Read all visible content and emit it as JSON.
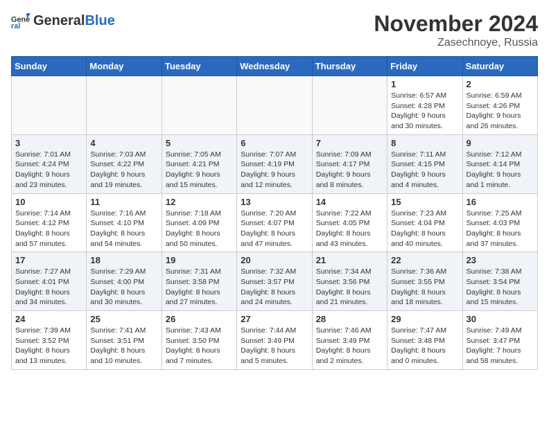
{
  "logo": {
    "text_general": "General",
    "text_blue": "Blue"
  },
  "title": {
    "month": "November 2024",
    "location": "Zasechnoye, Russia"
  },
  "weekdays": [
    "Sunday",
    "Monday",
    "Tuesday",
    "Wednesday",
    "Thursday",
    "Friday",
    "Saturday"
  ],
  "weeks": [
    [
      {
        "day": "",
        "info": ""
      },
      {
        "day": "",
        "info": ""
      },
      {
        "day": "",
        "info": ""
      },
      {
        "day": "",
        "info": ""
      },
      {
        "day": "",
        "info": ""
      },
      {
        "day": "1",
        "info": "Sunrise: 6:57 AM\nSunset: 4:28 PM\nDaylight: 9 hours and 30 minutes."
      },
      {
        "day": "2",
        "info": "Sunrise: 6:59 AM\nSunset: 4:26 PM\nDaylight: 9 hours and 26 minutes."
      }
    ],
    [
      {
        "day": "3",
        "info": "Sunrise: 7:01 AM\nSunset: 4:24 PM\nDaylight: 9 hours and 23 minutes."
      },
      {
        "day": "4",
        "info": "Sunrise: 7:03 AM\nSunset: 4:22 PM\nDaylight: 9 hours and 19 minutes."
      },
      {
        "day": "5",
        "info": "Sunrise: 7:05 AM\nSunset: 4:21 PM\nDaylight: 9 hours and 15 minutes."
      },
      {
        "day": "6",
        "info": "Sunrise: 7:07 AM\nSunset: 4:19 PM\nDaylight: 9 hours and 12 minutes."
      },
      {
        "day": "7",
        "info": "Sunrise: 7:09 AM\nSunset: 4:17 PM\nDaylight: 9 hours and 8 minutes."
      },
      {
        "day": "8",
        "info": "Sunrise: 7:11 AM\nSunset: 4:15 PM\nDaylight: 9 hours and 4 minutes."
      },
      {
        "day": "9",
        "info": "Sunrise: 7:12 AM\nSunset: 4:14 PM\nDaylight: 9 hours and 1 minute."
      }
    ],
    [
      {
        "day": "10",
        "info": "Sunrise: 7:14 AM\nSunset: 4:12 PM\nDaylight: 8 hours and 57 minutes."
      },
      {
        "day": "11",
        "info": "Sunrise: 7:16 AM\nSunset: 4:10 PM\nDaylight: 8 hours and 54 minutes."
      },
      {
        "day": "12",
        "info": "Sunrise: 7:18 AM\nSunset: 4:09 PM\nDaylight: 8 hours and 50 minutes."
      },
      {
        "day": "13",
        "info": "Sunrise: 7:20 AM\nSunset: 4:07 PM\nDaylight: 8 hours and 47 minutes."
      },
      {
        "day": "14",
        "info": "Sunrise: 7:22 AM\nSunset: 4:05 PM\nDaylight: 8 hours and 43 minutes."
      },
      {
        "day": "15",
        "info": "Sunrise: 7:23 AM\nSunset: 4:04 PM\nDaylight: 8 hours and 40 minutes."
      },
      {
        "day": "16",
        "info": "Sunrise: 7:25 AM\nSunset: 4:03 PM\nDaylight: 8 hours and 37 minutes."
      }
    ],
    [
      {
        "day": "17",
        "info": "Sunrise: 7:27 AM\nSunset: 4:01 PM\nDaylight: 8 hours and 34 minutes."
      },
      {
        "day": "18",
        "info": "Sunrise: 7:29 AM\nSunset: 4:00 PM\nDaylight: 8 hours and 30 minutes."
      },
      {
        "day": "19",
        "info": "Sunrise: 7:31 AM\nSunset: 3:58 PM\nDaylight: 8 hours and 27 minutes."
      },
      {
        "day": "20",
        "info": "Sunrise: 7:32 AM\nSunset: 3:57 PM\nDaylight: 8 hours and 24 minutes."
      },
      {
        "day": "21",
        "info": "Sunrise: 7:34 AM\nSunset: 3:56 PM\nDaylight: 8 hours and 21 minutes."
      },
      {
        "day": "22",
        "info": "Sunrise: 7:36 AM\nSunset: 3:55 PM\nDaylight: 8 hours and 18 minutes."
      },
      {
        "day": "23",
        "info": "Sunrise: 7:38 AM\nSunset: 3:54 PM\nDaylight: 8 hours and 15 minutes."
      }
    ],
    [
      {
        "day": "24",
        "info": "Sunrise: 7:39 AM\nSunset: 3:52 PM\nDaylight: 8 hours and 13 minutes."
      },
      {
        "day": "25",
        "info": "Sunrise: 7:41 AM\nSunset: 3:51 PM\nDaylight: 8 hours and 10 minutes."
      },
      {
        "day": "26",
        "info": "Sunrise: 7:43 AM\nSunset: 3:50 PM\nDaylight: 8 hours and 7 minutes."
      },
      {
        "day": "27",
        "info": "Sunrise: 7:44 AM\nSunset: 3:49 PM\nDaylight: 8 hours and 5 minutes."
      },
      {
        "day": "28",
        "info": "Sunrise: 7:46 AM\nSunset: 3:49 PM\nDaylight: 8 hours and 2 minutes."
      },
      {
        "day": "29",
        "info": "Sunrise: 7:47 AM\nSunset: 3:48 PM\nDaylight: 8 hours and 0 minutes."
      },
      {
        "day": "30",
        "info": "Sunrise: 7:49 AM\nSunset: 3:47 PM\nDaylight: 7 hours and 58 minutes."
      }
    ]
  ]
}
